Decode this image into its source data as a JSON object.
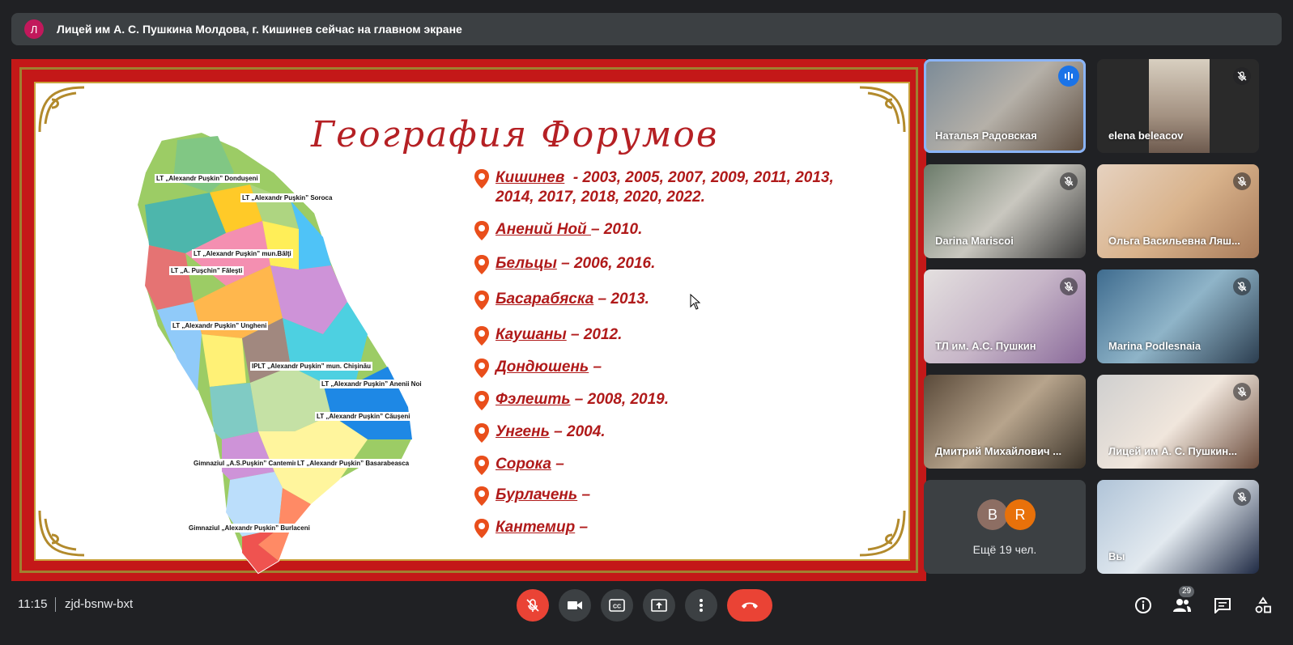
{
  "banner": {
    "avatar_letter": "Л",
    "text": "Лицей им А. С. Пушкина Молдова, г. Кишинев сейчас на главном экране"
  },
  "slide": {
    "title": "География Форумов",
    "forums": [
      {
        "city": "Кишинев",
        "years": "  - 2003, 2005, 2007, 2009, 2011, 2013,",
        "years2": "2014, 2017, 2018, 2020, 2022."
      },
      {
        "city": "Анений Ной ",
        "years": "– 2010."
      },
      {
        "city": "Бельцы",
        "years": " – 2006, 2016."
      },
      {
        "city": "Басарабяска",
        "years": " – 2013."
      },
      {
        "city": "Каушаны",
        "years": " – 2012."
      },
      {
        "city": "Дондюшень",
        "years": " –"
      },
      {
        "city": "Фэлешть",
        "years": " – 2008, 2019."
      },
      {
        "city": "Унгень",
        "years": " – 2004."
      },
      {
        "city": "Сорока",
        "years": " –"
      },
      {
        "city": "Бурлачень",
        "years": " –"
      },
      {
        "city": "Кантемир",
        "years": " –"
      }
    ],
    "map_labels": [
      "LT „Alexandr Puşkin” Donduşeni",
      "LT „Alexandr Puşkin” Soroca",
      "LT „Alexandr Puşkin” mun.Bălţi",
      "LT „A. Puşchin” Făleşti",
      "LT „Alexandr Puşkin” Ungheni",
      "IPLT „Alexandr Puşkin” mun. Chişinău",
      "LT „Alexandr Puşkin” Anenii Noi",
      "LT „Alexandr Puşkin” Căuşeni",
      "Gimnaziul „A.S.Puşkin” Cantemir",
      "LT „Alexandr Puşkin” Basarabeasca",
      "Gimnaziul „Alexandr Puşkin” Burlaceni"
    ]
  },
  "participants": [
    {
      "name": "Наталья Радовская",
      "speaking": true
    },
    {
      "name": "elena beleacov",
      "muted": true
    },
    {
      "name": "Darina Mariscoi",
      "muted": true
    },
    {
      "name": "Ольга Васильевна Ляш...",
      "muted": true
    },
    {
      "name": "ТЛ им. А.С. Пушкин",
      "muted": true
    },
    {
      "name": "Marina Podlesnaia",
      "muted": true
    },
    {
      "name": "Дмитрий Михайлович ...",
      "muted": false
    },
    {
      "name": "Лицей им А. С. Пушкин...",
      "muted": true
    },
    {
      "name": "Вы",
      "muted": true
    }
  ],
  "more_participants": {
    "avatars": [
      {
        "letter": "B",
        "color": "#8d6e63"
      },
      {
        "letter": "R",
        "color": "#e8710a"
      }
    ],
    "label": "Ещё 19 чел."
  },
  "bottom_bar": {
    "time": "11:15",
    "meeting_code": "zjd-bsnw-bxt",
    "people_count": "29"
  },
  "colors": {
    "background": "#202124",
    "end_call": "#ea4335",
    "active_outline": "#8ab4f8",
    "slide_red": "#c41818"
  }
}
